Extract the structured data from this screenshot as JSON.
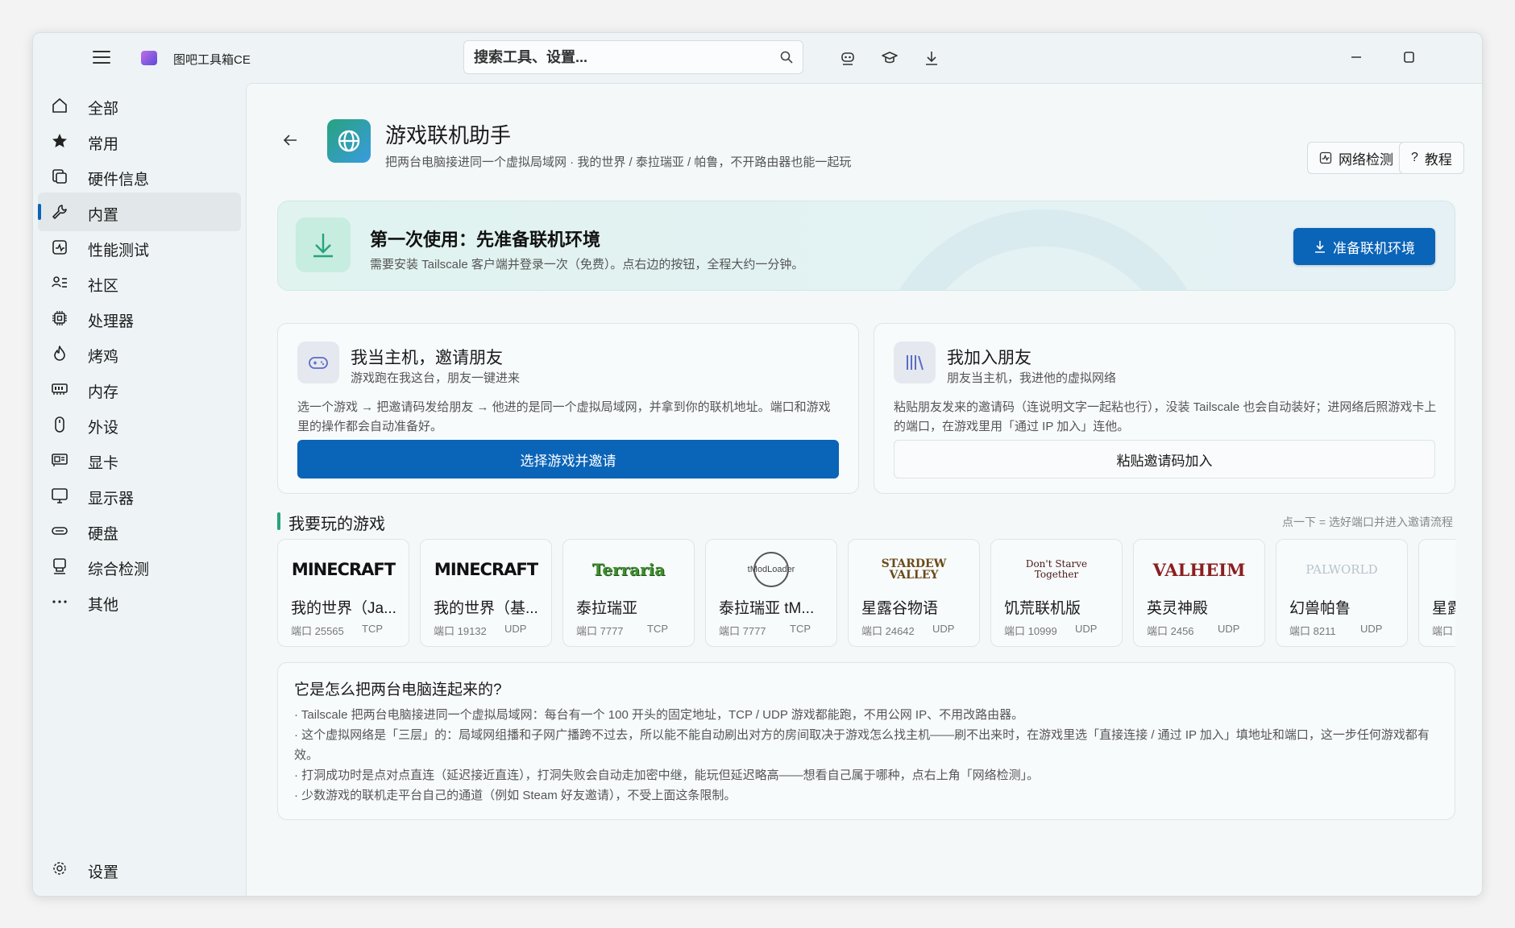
{
  "app": {
    "title": "图吧工具箱CE"
  },
  "search": {
    "placeholder": "搜索工具、设置..."
  },
  "sidebar": {
    "items": [
      {
        "label": "全部",
        "icon": "home-icon"
      },
      {
        "label": "常用",
        "icon": "star-icon"
      },
      {
        "label": "硬件信息",
        "icon": "hardware-info-icon"
      },
      {
        "label": "内置",
        "icon": "wrench-icon"
      },
      {
        "label": "性能测试",
        "icon": "benchmark-icon"
      },
      {
        "label": "社区",
        "icon": "community-icon"
      },
      {
        "label": "处理器",
        "icon": "cpu-icon"
      },
      {
        "label": "烤鸡",
        "icon": "flame-icon"
      },
      {
        "label": "内存",
        "icon": "memory-icon"
      },
      {
        "label": "外设",
        "icon": "mouse-icon"
      },
      {
        "label": "显卡",
        "icon": "gpu-icon"
      },
      {
        "label": "显示器",
        "icon": "monitor-icon"
      },
      {
        "label": "硬盘",
        "icon": "disk-icon"
      },
      {
        "label": "综合检测",
        "icon": "diagnostics-icon"
      },
      {
        "label": "其他",
        "icon": "more-icon"
      }
    ],
    "active_index": 3,
    "settings_label": "设置"
  },
  "header": {
    "title": "游戏联机助手",
    "subtitle": "把两台电脑接进同一个虚拟局域网 · 我的世界 / 泰拉瑞亚 / 帕鲁，不开路由器也能一起玩",
    "network_check_label": "网络检测",
    "tutorial_label": "教程"
  },
  "banner": {
    "title": "第一次使用：先准备联机环境",
    "subtitle": "需要安装 Tailscale 客户端并登录一次（免费）。点右边的按钮，全程大约一分钟。",
    "button_label": "准备联机环境"
  },
  "host_card": {
    "title": "我当主机，邀请朋友",
    "subtitle": "游戏跑在我这台，朋友一键进来",
    "desc": "选一个游戏 → 把邀请码发给朋友 → 他进的是同一个虚拟局域网，并拿到你的联机地址。端口和游戏里的操作都会自动准备好。",
    "button_label": "选择游戏并邀请"
  },
  "join_card": {
    "title": "我加入朋友",
    "subtitle": "朋友当主机，我进他的虚拟网络",
    "desc": "粘贴朋友发来的邀请码（连说明文字一起粘也行），没装 Tailscale 也会自动装好；进网络后照游戏卡上的端口，在游戏里用「通过 IP 加入」连他。",
    "button_label": "粘贴邀请码加入"
  },
  "games_section": {
    "title": "我要玩的游戏",
    "hint": "点一下 = 选好端口并进入邀请流程",
    "games": [
      {
        "name": "我的世界（Ja...",
        "port": "端口 25565",
        "proto": "TCP",
        "logo": "MINECRAFT"
      },
      {
        "name": "我的世界（基...",
        "port": "端口 19132",
        "proto": "UDP",
        "logo": "MINECRAFT"
      },
      {
        "name": "泰拉瑞亚",
        "port": "端口 7777",
        "proto": "TCP",
        "logo": "Terraria"
      },
      {
        "name": "泰拉瑞亚 tM...",
        "port": "端口 7777",
        "proto": "TCP",
        "logo": "tModLoader"
      },
      {
        "name": "星露谷物语",
        "port": "端口 24642",
        "proto": "UDP",
        "logo": "STARDEW VALLEY"
      },
      {
        "name": "饥荒联机版",
        "port": "端口 10999",
        "proto": "UDP",
        "logo": "Don't Starve Together"
      },
      {
        "name": "英灵神殿",
        "port": "端口 2456",
        "proto": "UDP",
        "logo": "VALHEIM"
      },
      {
        "name": "幻兽帕鲁",
        "port": "端口 8211",
        "proto": "UDP",
        "logo": "PALWORLD"
      },
      {
        "name": "星露",
        "port": "端口",
        "proto": "",
        "logo": "S"
      }
    ]
  },
  "info": {
    "title": "它是怎么把两台电脑连起来的?",
    "lines": [
      "· Tailscale 把两台电脑接进同一个虚拟局域网：每台有一个 100 开头的固定地址，TCP / UDP 游戏都能跑，不用公网 IP、不用改路由器。",
      "· 这个虚拟网络是「三层」的：局域网组播和子网广播跨不过去，所以能不能自动刷出对方的房间取决于游戏怎么找主机——刷不出来时，在游戏里选「直接连接 / 通过 IP 加入」填地址和端口，这一步任何游戏都有效。",
      "· 打洞成功时是点对点直连（延迟接近直连），打洞失败会自动走加密中继，能玩但延迟略高——想看自己属于哪种，点右上角「网络检测」。",
      "· 少数游戏的联机走平台自己的通道（例如 Steam 好友邀请），不受上面这条限制。"
    ]
  },
  "colors": {
    "accent": "#0a64b8",
    "green": "#27a37d"
  }
}
